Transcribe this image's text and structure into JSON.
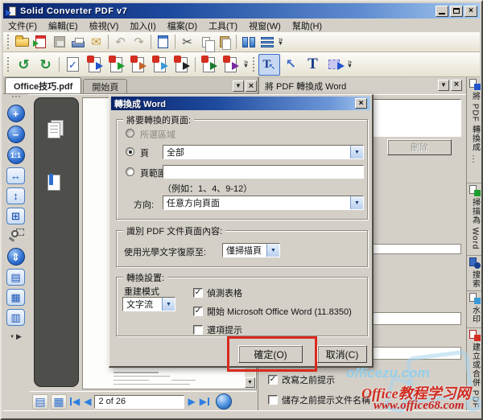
{
  "window": {
    "title": "Solid Converter PDF v7"
  },
  "menu": {
    "items": [
      "文件(F)",
      "編輯(E)",
      "檢視(V)",
      "加入(I)",
      "檔案(D)",
      "工具(T)",
      "視窗(W)",
      "幫助(H)"
    ]
  },
  "tabs": {
    "doc": "Office技巧.pdf",
    "start": "開始頁"
  },
  "panel": {
    "title": "將 PDF 轉換成 Word",
    "delete_label": "刪除",
    "check_overwrite": "改寫之前提示",
    "check_prompt_filename": "儲存之前提示文件名稱"
  },
  "dialog": {
    "title": "轉換成 Word",
    "group_pages": "將要轉換的頁面:",
    "radio_selection": "所選區域",
    "radio_pages": "頁",
    "pages_value": "全部",
    "radio_range": "頁範圍",
    "range_value": "",
    "range_hint": "（例如：1、4、9-12）",
    "direction_label": "方向:",
    "direction_value": "任意方向頁面",
    "group_ocr": "識別 PDF 文件頁面內容:",
    "ocr_label": "使用光學文字復原至:",
    "ocr_value": "僅掃描頁",
    "group_settings": "轉換設置:",
    "rebuild_label": "重建模式",
    "rebuild_value": "文字流",
    "check_tables": "偵測表格",
    "check_open_word": "開始 Microsoft Office Word (11.8350)",
    "check_prompt": "選項提示",
    "ok": "確定(O)",
    "cancel": "取消(C)"
  },
  "right_tabs": {
    "convert": "將 PDF 轉換成 ...",
    "scan": "掃描為 Word",
    "search": "搜索",
    "watermark": "水印",
    "create": "建立或合併 PDF"
  },
  "pager": {
    "value": "2 of 26"
  },
  "watermarks": {
    "line1": "officezu.com",
    "line2": "Office教程学习网",
    "line3": "www.office68.com"
  },
  "glyphs": {
    "undo": "↶",
    "redo": "↷",
    "cut": "✂",
    "email": "✉",
    "chevron": "»",
    "chevron_down": "▼",
    "combo_arrow": "▼",
    "close": "×",
    "zoom_in": "+",
    "zoom_out": "−",
    "actual_size": "1:1",
    "fit_width": "↔",
    "fit_height": "↕",
    "fit_page": "⊞",
    "scroll_pages": "⇕",
    "single_page": "▤",
    "facing_pages": "▦",
    "continuous": "▥",
    "pointer": "↖",
    "text_tool": "T",
    "prev": "◀",
    "next": "▶",
    "check": "✓",
    "rot_left": "↺",
    "rot_right": "↻",
    "overflow_play": "▶"
  },
  "colors": {
    "titlebar_left": "#0a246a",
    "titlebar_right": "#a6caf0",
    "annotation_red": "#da2a1e",
    "watermark_red": "#d02c20",
    "watermark_blue": "#91cdeb",
    "window_gray": "#d4d0c8"
  }
}
